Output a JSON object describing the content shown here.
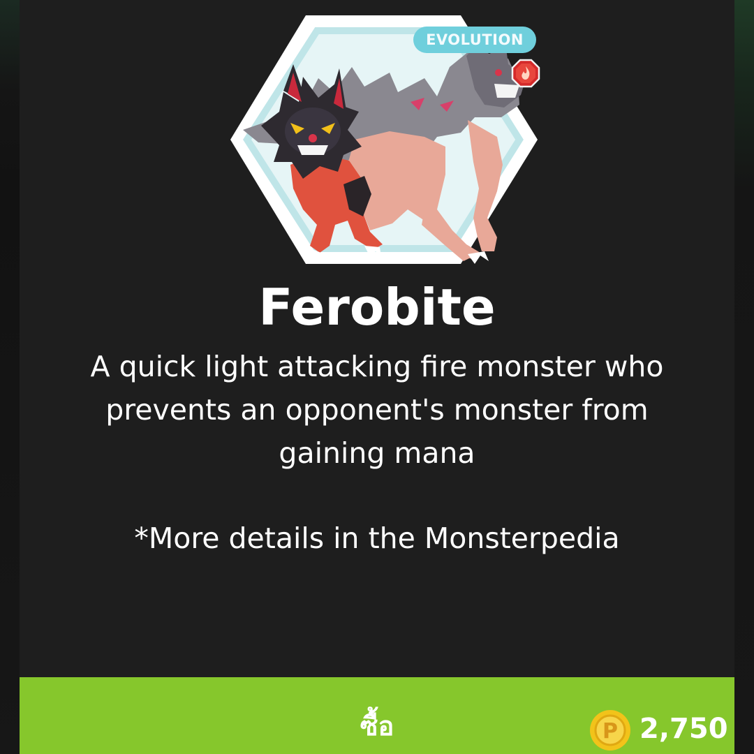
{
  "monster": {
    "badge": "EVOLUTION",
    "element_icon": "fire-gem-icon",
    "name": "Ferobite",
    "description": "A quick light attacking fire monster who prevents an opponent's monster from gaining mana",
    "note": "*More details in the Monsterpedia"
  },
  "purchase": {
    "button_label": "ซื้อ",
    "currency_icon": "coin-icon",
    "currency_symbol": "P",
    "price": "2,750"
  },
  "colors": {
    "panel_bg": "#1e1e1e",
    "buy_bar": "#86c72c",
    "badge_bg": "#6fcfdc",
    "coin": "#f2c31a",
    "gem": "#d42a2a"
  }
}
